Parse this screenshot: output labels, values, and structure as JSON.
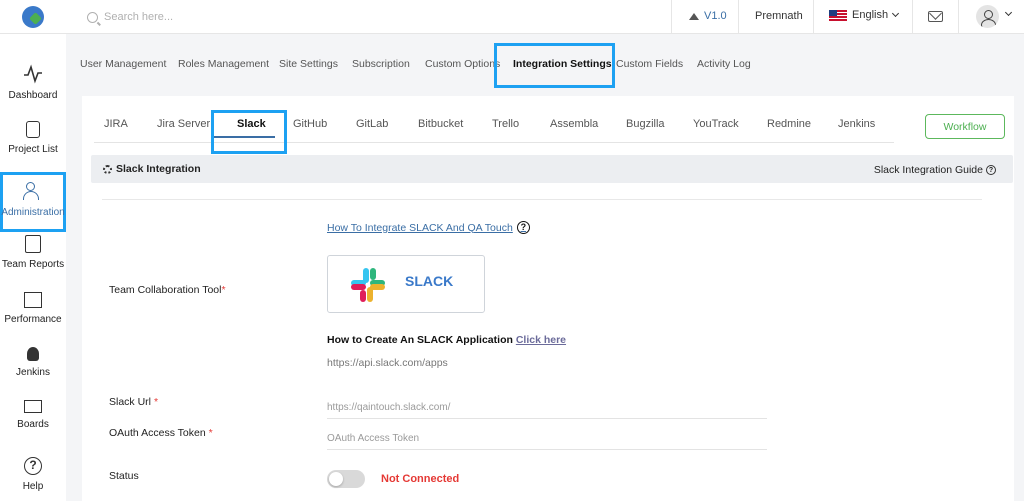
{
  "topbar": {
    "search_placeholder": "Search here...",
    "version": "V1.0",
    "user_name": "Premnath",
    "language": "English"
  },
  "sidebar": {
    "items": [
      {
        "label": "Dashboard",
        "icon": "activity-icon"
      },
      {
        "label": "Project List",
        "icon": "clipboard-icon"
      },
      {
        "label": "Administration",
        "icon": "users-icon",
        "active": true
      },
      {
        "label": "Team Reports",
        "icon": "report-icon"
      },
      {
        "label": "Performance",
        "icon": "chart-icon"
      },
      {
        "label": "Jenkins",
        "icon": "jenkins-icon"
      },
      {
        "label": "Boards",
        "icon": "board-icon"
      },
      {
        "label": "Help",
        "icon": "help-icon"
      }
    ]
  },
  "admin_tabs": [
    "User Management",
    "Roles Management",
    "Site Settings",
    "Subscription",
    "Custom Options",
    "Integration Settings",
    "Custom Fields",
    "Activity Log"
  ],
  "admin_active_tab": "Integration Settings",
  "integration_tabs": [
    "JIRA",
    "Jira Server",
    "Slack",
    "GitHub",
    "GitLab",
    "Bitbucket",
    "Trello",
    "Assembla",
    "Bugzilla",
    "YouTrack",
    "Redmine",
    "Jenkins"
  ],
  "integration_active_tab": "Slack",
  "workflow_button": "Workflow",
  "panel": {
    "title": "Slack Integration",
    "guide_link": "Slack Integration Guide",
    "howto_link": "How To Integrate SLACK And QA Touch",
    "tool_label": "Team Collaboration Tool",
    "tool_name": "SLACK",
    "create_text": "How to Create An SLACK Application",
    "create_link": "Click here",
    "api_url": "https://api.slack.com/apps",
    "slack_url_label": "Slack Url",
    "slack_url_placeholder": "https://qaintouch.slack.com/",
    "token_label": "OAuth Access Token",
    "token_placeholder": "OAuth Access Token",
    "status_label": "Status",
    "status_value": "Not Connected"
  },
  "colors": {
    "accent": "#3a6ea5",
    "highlight": "#1da1f2",
    "status_error": "#e53935",
    "workflow_green": "#4caf50"
  }
}
